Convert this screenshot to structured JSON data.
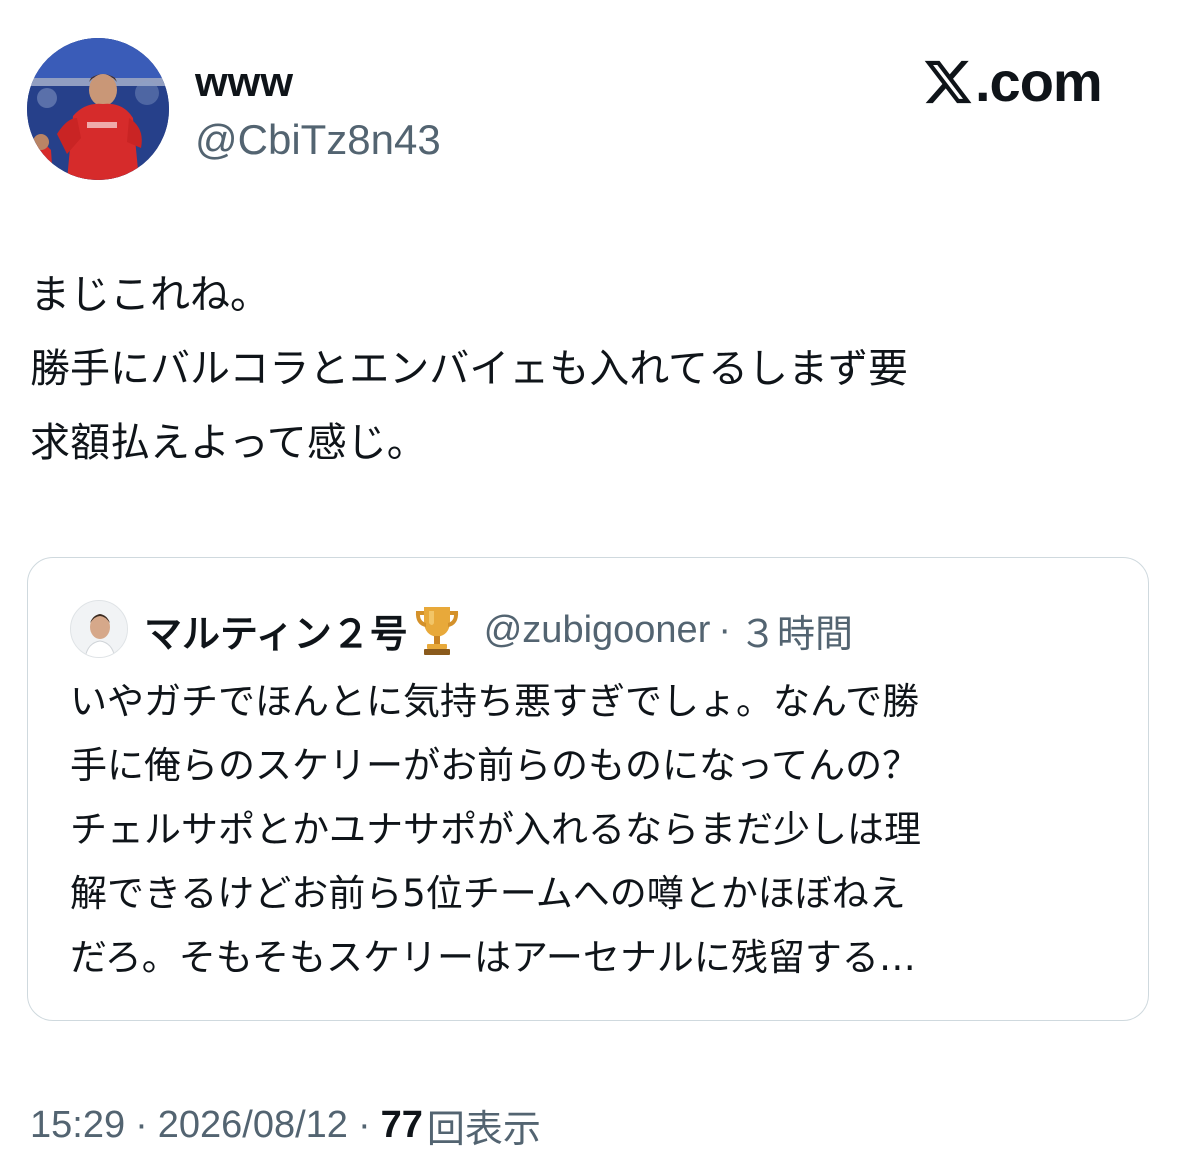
{
  "author": {
    "display_name": "www",
    "handle": "@CbiTz8n43",
    "avatar_icon": "profile-photo-footballer"
  },
  "brand": {
    "label": ".com",
    "icon": "x-logo-icon"
  },
  "tweet": {
    "lines": [
      "まじこれね。",
      "勝手にバルコラとエンバイェも入れてるしまず要",
      "求額払えよって感じ。"
    ]
  },
  "quote": {
    "display_name": "マルティン２号",
    "badge_icon": "trophy-icon",
    "handle": "@zubigooner",
    "separator": "·",
    "time": "３時間",
    "lines": [
      "いやガチでほんとに気持ち悪すぎでしょ。なんで勝",
      "手に俺らのスケリーがお前らのものになってんの？",
      "チェルサポとかユナサポが入れるならまだ少しは理",
      "解できるけどお前ら5位チームへの噂とかほぼねえ",
      "だろ。そもそもスケリーはアーセナルに残留する…"
    ]
  },
  "meta": {
    "time": "15:29",
    "separator": "·",
    "date": "2026/08/12",
    "views_count": "77",
    "views_label": "回表示"
  },
  "colors": {
    "text_primary": "#0f1419",
    "text_secondary": "#536471",
    "border": "#cfd9de",
    "background": "#ffffff"
  }
}
